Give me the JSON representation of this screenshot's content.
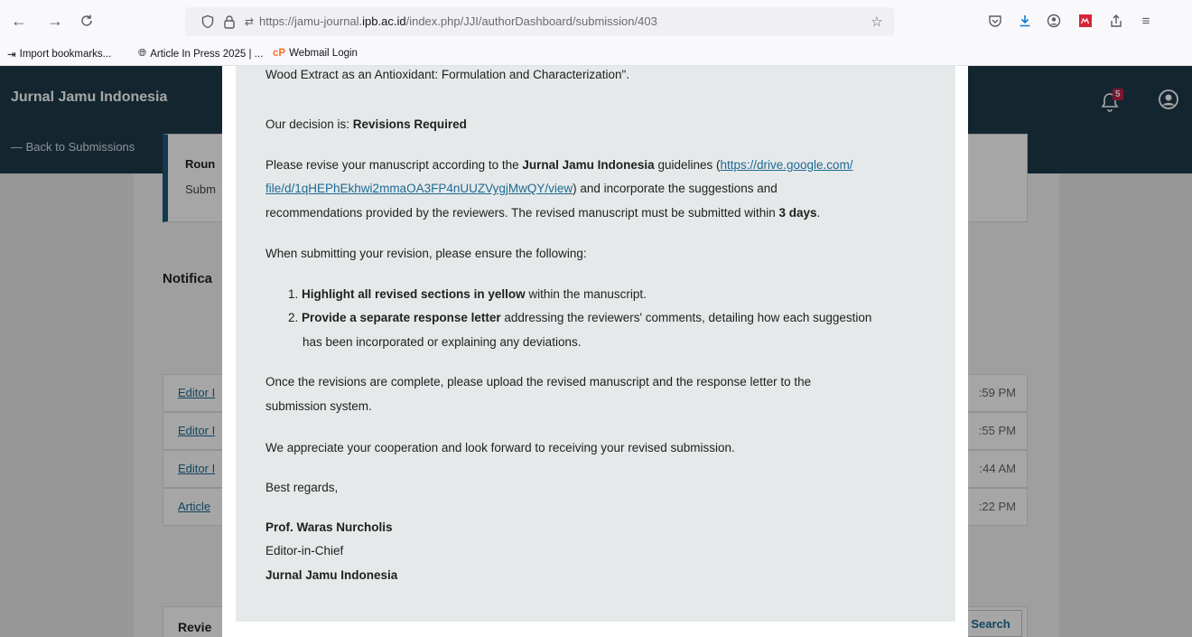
{
  "browser": {
    "url_prefix": "https://jamu-journal.",
    "url_domain": "ipb.ac.id",
    "url_path": "/index.php/JJI/authorDashboard/submission/403"
  },
  "bookmarks": [
    {
      "label": "Import bookmarks..."
    },
    {
      "label": "Article In Press 2025 | ..."
    },
    {
      "label": "Webmail Login"
    }
  ],
  "header": {
    "brand": "Jurnal Jamu Indonesia",
    "back_link": "— Back to Submissions",
    "notification_count": "5"
  },
  "background": {
    "round_title": "Roun",
    "round_sub": "Subm",
    "notifications_title": "Notifica",
    "notifications": [
      {
        "link": "Editor I",
        "time": ":59 PM"
      },
      {
        "link": "Editor I",
        "time": ":55 PM"
      },
      {
        "link": "Editor I",
        "time": ":44 AM"
      },
      {
        "link": "Article",
        "time": ":22 PM"
      }
    ],
    "review_label": "Revie",
    "search_label": "Search"
  },
  "modal": {
    "line_top": "Wood Extract as an Antioxidant: Formulation and Characterization\".",
    "decision_prefix": "Our decision is: ",
    "decision_value": "Revisions Required",
    "revise_1": "Please revise your manuscript according to the ",
    "journal_name": "Jurnal Jamu Indonesia",
    "revise_2": " guidelines (",
    "guideline_link_1": "https://drive.google.com/",
    "guideline_link_2": "file/d/1qHEPhEkhwi2mmaOA3FP4nUUZVygjMwQY/view",
    "revise_3": ") and incorporate the suggestions and",
    "revise_4": "recommendations provided by the reviewers. The revised manuscript must be submitted within ",
    "deadline": "3 days",
    "revise_5": ".",
    "ensure_text": "When submitting your revision, please ensure the following:",
    "item1_num": "1. ",
    "item1_bold": "Highlight all revised sections in yellow",
    "item1_rest": " within the manuscript.",
    "item2_num": "2. ",
    "item2_bold": "Provide a separate response letter",
    "item2_rest": " addressing the reviewers' comments, detailing how each suggestion",
    "item2_cont": "has been incorporated or explaining any deviations.",
    "once_1": "Once the revisions are complete, please upload the revised manuscript and the response letter to the",
    "once_2": "submission system.",
    "appreciate": "We appreciate your cooperation and look forward to receiving your revised submission.",
    "regards": "Best regards,",
    "sig_name": "Prof. Waras Nurcholis",
    "sig_title": "Editor-in-Chief",
    "sig_journal": "Jurnal Jamu Indonesia"
  }
}
